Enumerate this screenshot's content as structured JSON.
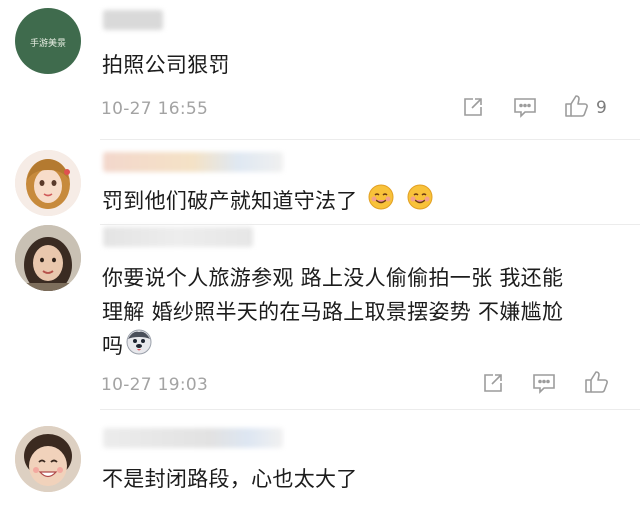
{
  "comments": [
    {
      "avatar": "green-seal-avatar",
      "avatar_text": "手游美景",
      "text": "拍照公司狠罚",
      "time": "10-27 16:55",
      "likes": "9"
    },
    {
      "avatar": "cartoon-girl-avatar",
      "text": "罚到他们破产就知道守法了",
      "emojis": [
        "yummy-face-emoji",
        "yummy-face-emoji"
      ]
    },
    {
      "avatar": "woman-photo-avatar",
      "text_lines": [
        "你要说个人旅游参观 路上没人偷偷拍一张 我还能",
        "理解 婚纱照半天的在马路上取景摆姿势 不嫌尴尬",
        "吗"
      ],
      "emoji": "husky-face-emoji",
      "time": "10-27 19:03"
    },
    {
      "avatar": "smiling-child-avatar",
      "text": "不是封闭路段，心也太大了"
    }
  ],
  "icons": {
    "share": "share-icon",
    "comment": "comment-icon",
    "like": "thumbs-up-icon"
  },
  "colors": {
    "avatar_green": "#3f6b4d",
    "meta_gray": "#a3a3a3"
  }
}
